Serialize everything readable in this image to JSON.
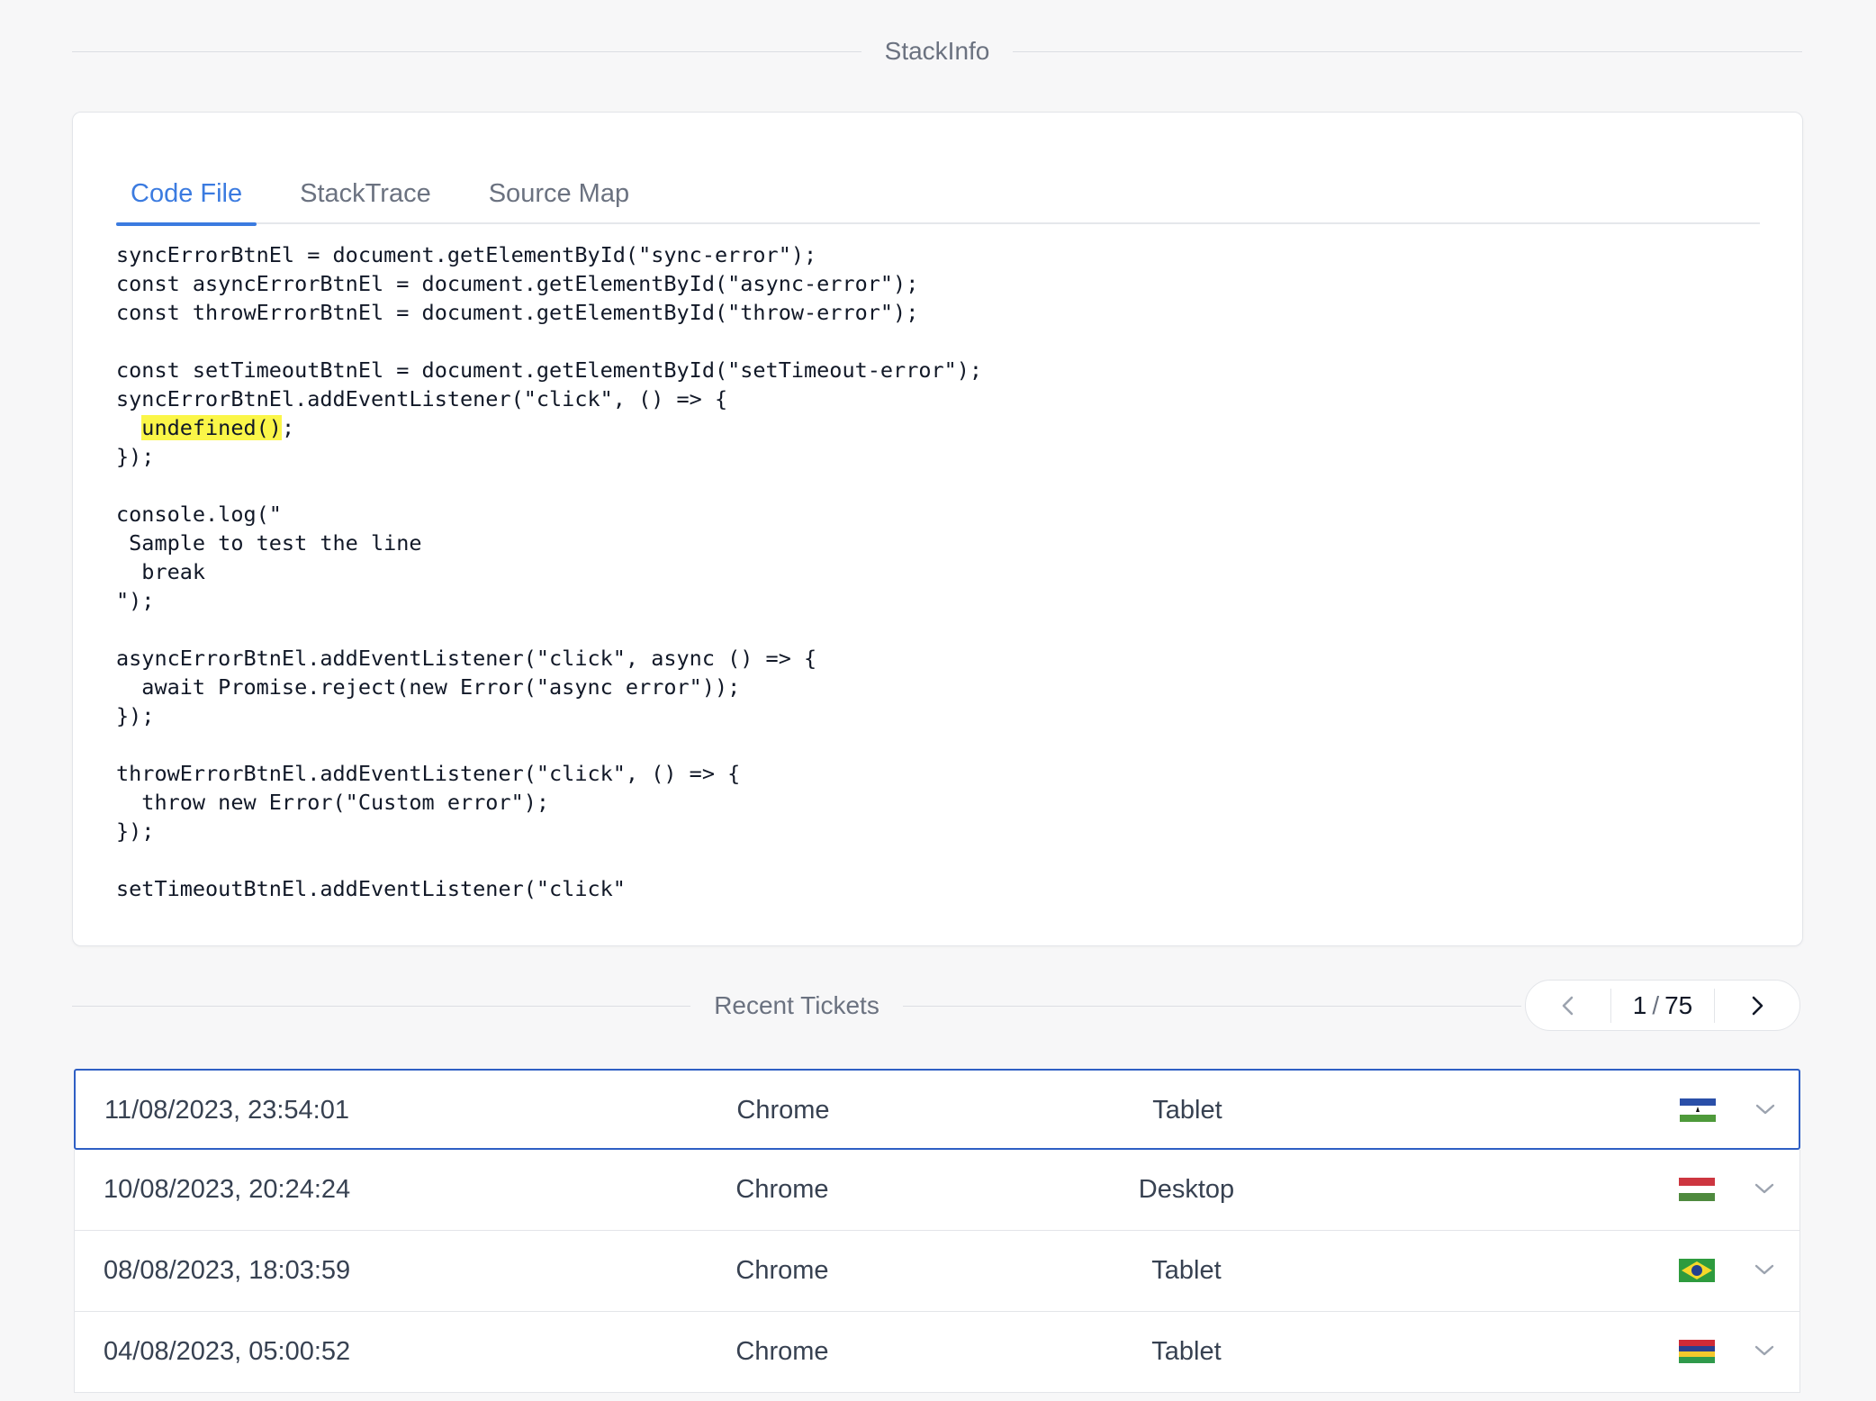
{
  "stackinfo": {
    "title": "StackInfo"
  },
  "tabs": [
    {
      "label": "Code File",
      "active": true
    },
    {
      "label": "StackTrace",
      "active": false
    },
    {
      "label": "Source Map",
      "active": false
    }
  ],
  "code": {
    "before_highlight": "syncErrorBtnEl = document.getElementById(\"sync-error\");\nconst asyncErrorBtnEl = document.getElementById(\"async-error\");\nconst throwErrorBtnEl = document.getElementById(\"throw-error\");\n\nconst setTimeoutBtnEl = document.getElementById(\"setTimeout-error\");\nsyncErrorBtnEl.addEventListener(\"click\", () => {\n  ",
    "highlight": "undefined()",
    "after_highlight": ";\n});\n\nconsole.log(\"\n Sample to test the line\n  break\n\");\n\nasyncErrorBtnEl.addEventListener(\"click\", async () => {\n  await Promise.reject(new Error(\"async error\"));\n});\n\nthrowErrorBtnEl.addEventListener(\"click\", () => {\n  throw new Error(\"Custom error\");\n});\n\nsetTimeoutBtnEl.addEventListener(\"click\"",
    "highlight_color": "#fbf648"
  },
  "tickets_section": {
    "title": "Recent Tickets",
    "pager": {
      "current": "1",
      "separator": "/",
      "total": "75"
    }
  },
  "tickets": [
    {
      "datetime": "11/08/2023, 23:54:01",
      "browser": "Chrome",
      "device": "Tablet",
      "flag": "lesotho-flag-icon",
      "selected": true
    },
    {
      "datetime": "10/08/2023, 20:24:24",
      "browser": "Chrome",
      "device": "Desktop",
      "flag": "hungary-flag-icon",
      "selected": false
    },
    {
      "datetime": "08/08/2023, 18:03:59",
      "browser": "Chrome",
      "device": "Tablet",
      "flag": "brazil-flag-icon",
      "selected": false
    },
    {
      "datetime": "04/08/2023, 05:00:52",
      "browser": "Chrome",
      "device": "Tablet",
      "flag": "mauritius-flag-icon",
      "selected": false
    }
  ],
  "colors": {
    "accent": "#3b7be0",
    "selected_border": "#2f5fc4",
    "background": "#f7f7f8"
  }
}
